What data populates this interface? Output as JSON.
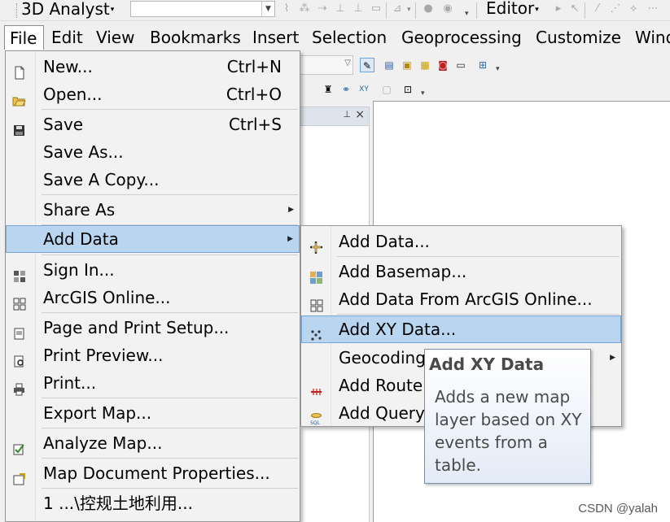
{
  "toolbar": {
    "analyst_label": "3D Analyst",
    "editor_label": "Editor"
  },
  "menubar": {
    "items": [
      "File",
      "Edit",
      "View",
      "Bookmarks",
      "Insert",
      "Selection",
      "Geoprocessing",
      "Customize",
      "Wind"
    ]
  },
  "file_menu": {
    "items": [
      {
        "label": "New...",
        "shortcut": "Ctrl+N",
        "icon": "new-document-icon"
      },
      {
        "label": "Open...",
        "shortcut": "Ctrl+O",
        "icon": "open-folder-icon"
      },
      {
        "label": "Save",
        "shortcut": "Ctrl+S",
        "icon": "save-disk-icon"
      },
      {
        "label": "Save As...",
        "shortcut": ""
      },
      {
        "label": "Save A Copy...",
        "shortcut": ""
      },
      {
        "label": "Share As",
        "shortcut": ""
      },
      {
        "label": "Add Data",
        "shortcut": ""
      },
      {
        "label": "Sign In...",
        "icon": "grid-icon"
      },
      {
        "label": "ArcGIS Online...",
        "icon": "grid-icon"
      },
      {
        "label": "Page and Print Setup...",
        "icon": "page-setup-icon"
      },
      {
        "label": "Print Preview...",
        "icon": "print-preview-icon"
      },
      {
        "label": "Print...",
        "icon": "printer-icon"
      },
      {
        "label": "Export Map...",
        "icon": ""
      },
      {
        "label": "Analyze Map...",
        "icon": "analyze-check-icon"
      },
      {
        "label": "Map Document Properties...",
        "icon": "map-properties-icon"
      },
      {
        "label": "1 ...\\控规土地利用...",
        "icon": ""
      }
    ]
  },
  "add_data_submenu": {
    "items": [
      {
        "label": "Add Data...",
        "icon": "add-data-plus-icon"
      },
      {
        "label": "Add Basemap...",
        "icon": "basemap-icon"
      },
      {
        "label": "Add Data From ArcGIS Online...",
        "icon": "grid-icon"
      },
      {
        "label": "Add XY Data...",
        "icon": "xy-data-icon"
      },
      {
        "label": "Geocoding",
        "icon": ""
      },
      {
        "label": "Add Route",
        "icon": "route-icon"
      },
      {
        "label": "Add Query",
        "icon": "sql-query-icon"
      }
    ]
  },
  "tooltip": {
    "title": "Add XY Data",
    "body": "Adds a new map layer based on XY events from a table."
  },
  "watermark": "CSDN @yalah",
  "colors": {
    "highlight": "#b9d5f0",
    "highlight_border": "#75a4d8",
    "menu_bg": "#f2f2f2"
  }
}
